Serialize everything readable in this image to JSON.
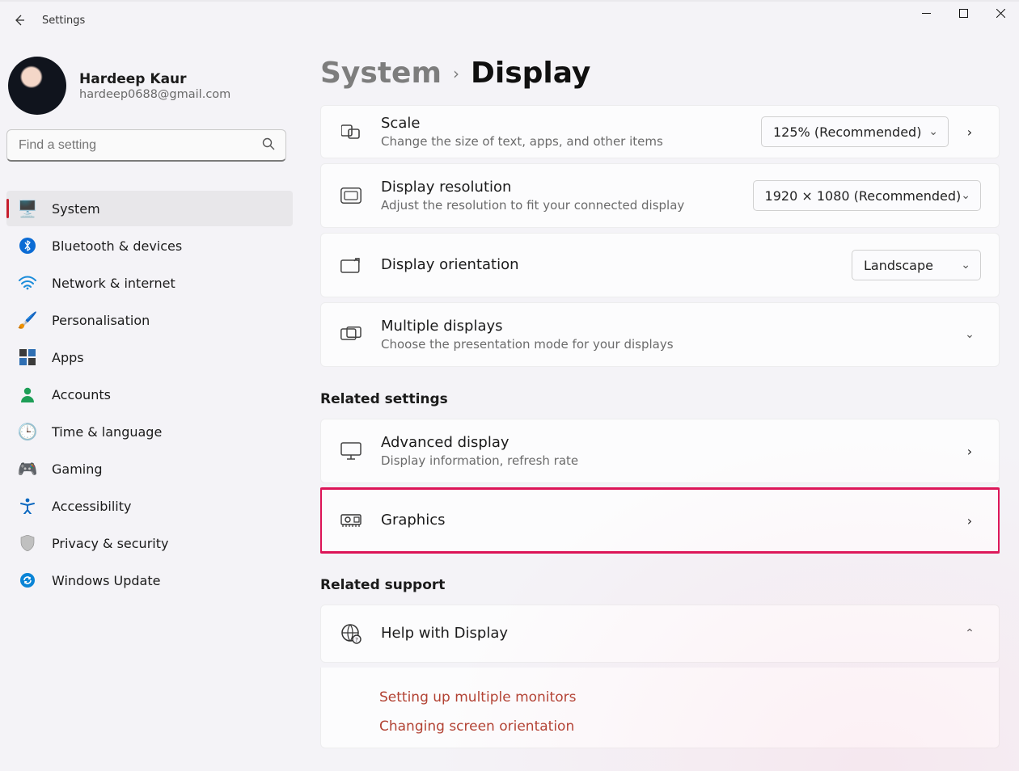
{
  "app": {
    "title": "Settings"
  },
  "wincontrols": {
    "minimize": "minimize-icon",
    "maximize": "maximize-icon",
    "close": "close-icon"
  },
  "user": {
    "name": "Hardeep Kaur",
    "email": "hardeep0688@gmail.com"
  },
  "search": {
    "placeholder": "Find a setting"
  },
  "sidebar": {
    "items": [
      {
        "label": "System",
        "selected": true
      },
      {
        "label": "Bluetooth & devices",
        "selected": false
      },
      {
        "label": "Network & internet",
        "selected": false
      },
      {
        "label": "Personalisation",
        "selected": false
      },
      {
        "label": "Apps",
        "selected": false
      },
      {
        "label": "Accounts",
        "selected": false
      },
      {
        "label": "Time & language",
        "selected": false
      },
      {
        "label": "Gaming",
        "selected": false
      },
      {
        "label": "Accessibility",
        "selected": false
      },
      {
        "label": "Privacy & security",
        "selected": false
      },
      {
        "label": "Windows Update",
        "selected": false
      }
    ]
  },
  "breadcrumb": {
    "parent": "System",
    "current": "Display"
  },
  "settings": {
    "scale": {
      "title": "Scale",
      "sub": "Change the size of text, apps, and other items",
      "value": "125% (Recommended)"
    },
    "resolution": {
      "title": "Display resolution",
      "sub": "Adjust the resolution to fit your connected display",
      "value": "1920 × 1080 (Recommended)"
    },
    "orientation": {
      "title": "Display orientation",
      "value": "Landscape"
    },
    "multidisplays": {
      "title": "Multiple displays",
      "sub": "Choose the presentation mode for your displays"
    }
  },
  "related_settings": {
    "section_title": "Related settings",
    "advanced": {
      "title": "Advanced display",
      "sub": "Display information, refresh rate"
    },
    "graphics": {
      "title": "Graphics"
    }
  },
  "related_support": {
    "section_title": "Related support",
    "help_card_title": "Help with Display",
    "links": [
      "Setting up multiple monitors",
      "Changing screen orientation"
    ]
  }
}
